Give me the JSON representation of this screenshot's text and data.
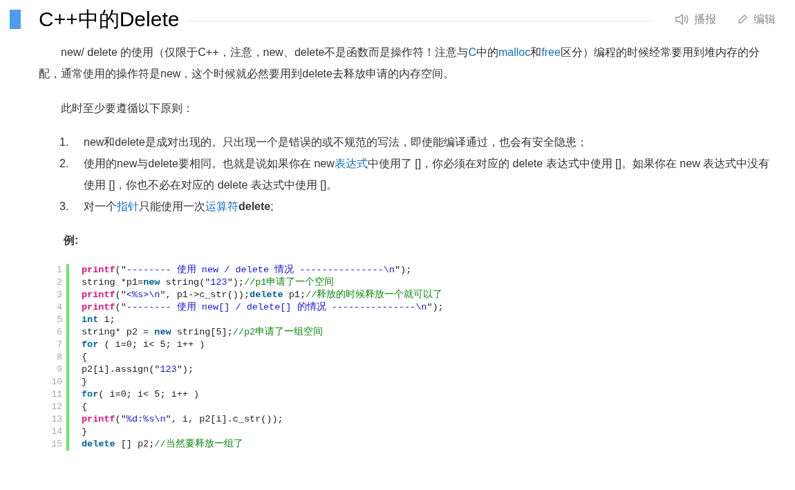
{
  "header": {
    "title": "C++中的Delete",
    "actions": [
      {
        "kind": "speaker",
        "label": "播报"
      },
      {
        "kind": "pencil",
        "label": "编辑"
      }
    ]
  },
  "intro": [
    {
      "kind": "text",
      "text": "new/ delete 的使用（仅限于C++，注意，new、delete不是函数而是操作符！注意与"
    },
    {
      "kind": "link",
      "text": "C"
    },
    {
      "kind": "text",
      "text": "中的"
    },
    {
      "kind": "link",
      "text": "malloc"
    },
    {
      "kind": "text",
      "text": "和"
    },
    {
      "kind": "link",
      "text": "free"
    },
    {
      "kind": "text",
      "text": "区分）编程的时候经常要用到堆内存的分配，通常使用的操作符是new，这个时候就必然要用到delete去释放申请的内存空间。"
    }
  ],
  "lead": "此时至少要遵循以下原则：",
  "rules": [
    {
      "number": "1.",
      "segments": [
        {
          "kind": "text",
          "text": "new和delete是成对出现的。只出现一个是错误的或不规范的写法，即使能编译通过，也会有安全隐患；"
        }
      ]
    },
    {
      "number": "2.",
      "segments": [
        {
          "kind": "text",
          "text": "使用的new与delete要相同。也就是说如果你在 new"
        },
        {
          "kind": "link",
          "text": "表达式"
        },
        {
          "kind": "text",
          "text": "中使用了 []，你必须在对应的 delete 表达式中使用 []。如果你在 new 表达式中没有使用 []，你也不必在对应的 delete 表达式中使用 []。"
        }
      ]
    },
    {
      "number": "3.",
      "segments": [
        {
          "kind": "text",
          "text": "对一个"
        },
        {
          "kind": "link",
          "text": "指针"
        },
        {
          "kind": "text",
          "text": "只能使用一次"
        },
        {
          "kind": "link",
          "text": "运算符"
        },
        {
          "kind": "bold",
          "text": "delete"
        },
        {
          "kind": "text",
          "text": ";"
        }
      ]
    }
  ],
  "example_label": "例:",
  "code": [
    {
      "number": "1",
      "tokens": [
        {
          "kind": "func",
          "text": "printf"
        },
        {
          "kind": "plain",
          "text": "(\""
        },
        {
          "kind": "str",
          "text": "-------- 使用 new / delete 情况 ---------------\\n"
        },
        {
          "kind": "plain",
          "text": "\");"
        }
      ]
    },
    {
      "number": "2",
      "tokens": [
        {
          "kind": "plain",
          "text": "string *p1="
        },
        {
          "kind": "kw",
          "text": "new"
        },
        {
          "kind": "plain",
          "text": " string(\""
        },
        {
          "kind": "str",
          "text": "123"
        },
        {
          "kind": "plain",
          "text": "\");"
        },
        {
          "kind": "cmt",
          "text": "//p1申请了一个空间"
        }
      ]
    },
    {
      "number": "3",
      "tokens": [
        {
          "kind": "func",
          "text": "printf"
        },
        {
          "kind": "plain",
          "text": "(\""
        },
        {
          "kind": "str",
          "text": "<%s>\\n"
        },
        {
          "kind": "plain",
          "text": "\", p1->c_str());"
        },
        {
          "kind": "kw",
          "text": "delete"
        },
        {
          "kind": "plain",
          "text": " p1;"
        },
        {
          "kind": "cmt",
          "text": "//释放的时候释放一个就可以了"
        }
      ]
    },
    {
      "number": "4",
      "tokens": [
        {
          "kind": "func",
          "text": "printf"
        },
        {
          "kind": "plain",
          "text": "(\""
        },
        {
          "kind": "str",
          "text": "-------- 使用 new[] / delete[] 的情况 ---------------\\n"
        },
        {
          "kind": "plain",
          "text": "\");"
        }
      ]
    },
    {
      "number": "5",
      "tokens": [
        {
          "kind": "kw",
          "text": "int"
        },
        {
          "kind": "plain",
          "text": " i;"
        }
      ]
    },
    {
      "number": "6",
      "tokens": [
        {
          "kind": "plain",
          "text": "string* p2 = "
        },
        {
          "kind": "kw",
          "text": "new"
        },
        {
          "kind": "plain",
          "text": " string[5];"
        },
        {
          "kind": "cmt",
          "text": "//p2申请了一组空间"
        }
      ]
    },
    {
      "number": "7",
      "tokens": [
        {
          "kind": "kw",
          "text": "for"
        },
        {
          "kind": "plain",
          "text": " ( i=0; i< 5; i++ )"
        }
      ]
    },
    {
      "number": "8",
      "tokens": [
        {
          "kind": "plain",
          "text": "{"
        }
      ]
    },
    {
      "number": "9",
      "tokens": [
        {
          "kind": "plain",
          "text": "p2[i].assign(\""
        },
        {
          "kind": "str",
          "text": "123"
        },
        {
          "kind": "plain",
          "text": "\");"
        }
      ]
    },
    {
      "number": "10",
      "tokens": [
        {
          "kind": "plain",
          "text": "}"
        }
      ]
    },
    {
      "number": "11",
      "tokens": [
        {
          "kind": "kw",
          "text": "for"
        },
        {
          "kind": "plain",
          "text": "( i=0; i< 5; i++ )"
        }
      ]
    },
    {
      "number": "12",
      "tokens": [
        {
          "kind": "plain",
          "text": "{"
        }
      ]
    },
    {
      "number": "13",
      "tokens": [
        {
          "kind": "func",
          "text": "printf"
        },
        {
          "kind": "plain",
          "text": "(\""
        },
        {
          "kind": "str",
          "text": "%d:%s\\n"
        },
        {
          "kind": "plain",
          "text": "\", i, p2[i].c_str());"
        }
      ]
    },
    {
      "number": "14",
      "tokens": [
        {
          "kind": "plain",
          "text": "}"
        }
      ]
    },
    {
      "number": "15",
      "tokens": [
        {
          "kind": "kw",
          "text": "delete"
        },
        {
          "kind": "plain",
          "text": " [] p2;"
        },
        {
          "kind": "cmt",
          "text": "//当然要释放一组了"
        }
      ]
    }
  ]
}
